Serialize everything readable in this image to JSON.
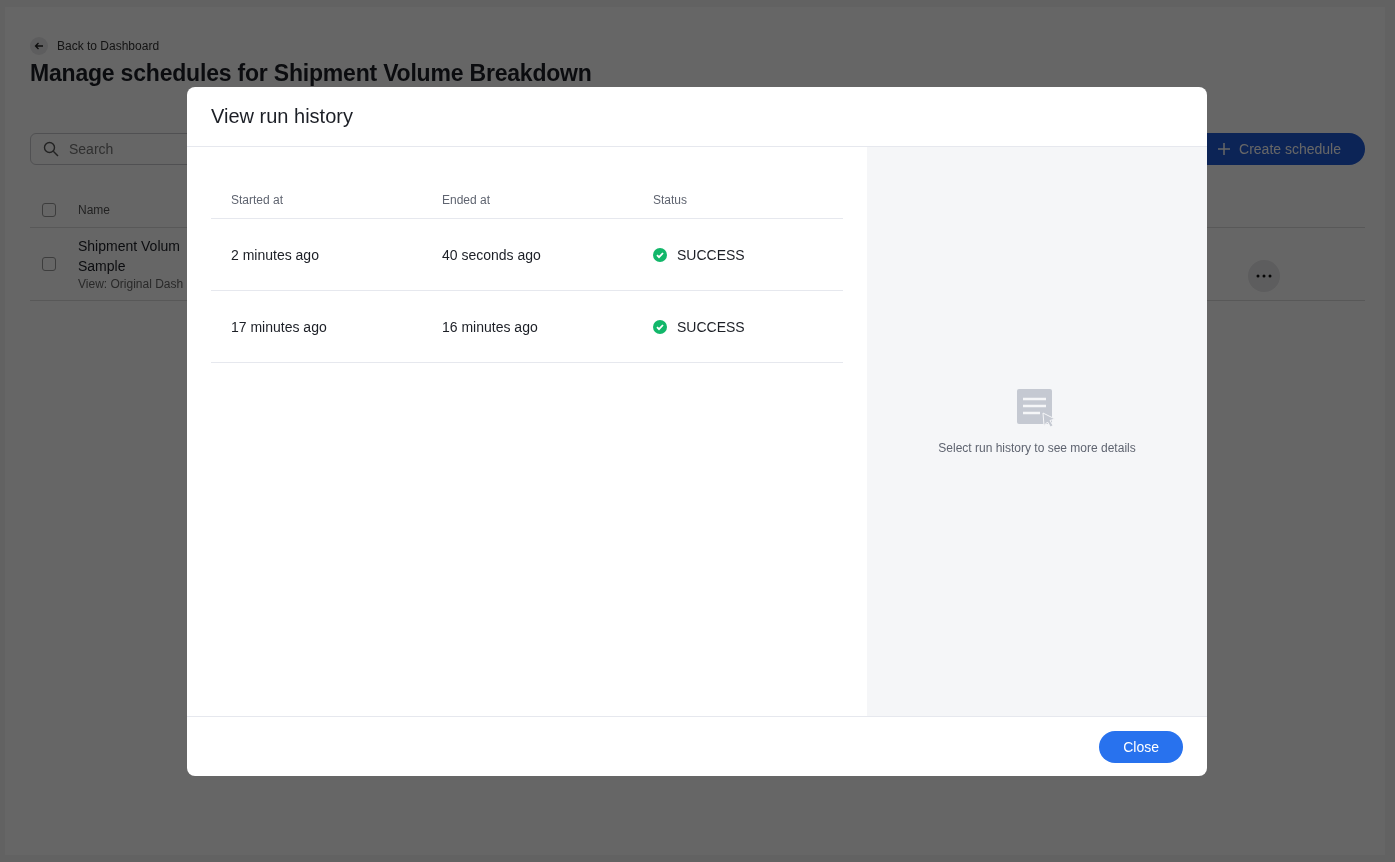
{
  "page": {
    "back_link": "Back to Dashboard",
    "title": "Manage schedules for Shipment Volume Breakdown",
    "search": {
      "placeholder": "Search"
    },
    "create_button": "Create schedule",
    "table": {
      "columns": [
        "Name"
      ],
      "header_checked": false,
      "rows": [
        {
          "checked": false,
          "name_lines": [
            "Shipment Volum",
            "Sample"
          ],
          "subtitle": "View: Original Dash"
        }
      ]
    }
  },
  "dialog": {
    "title": "View run history",
    "columns": [
      "Started at",
      "Ended at",
      "Status"
    ],
    "rows": [
      {
        "started": "2 minutes ago",
        "ended": "40 seconds ago",
        "status": "SUCCESS",
        "kind": "success"
      },
      {
        "started": "17 minutes ago",
        "ended": "16 minutes ago",
        "status": "SUCCESS",
        "kind": "success"
      }
    ],
    "empty_detail": "Select run history to see more details",
    "close_button": "Close"
  }
}
